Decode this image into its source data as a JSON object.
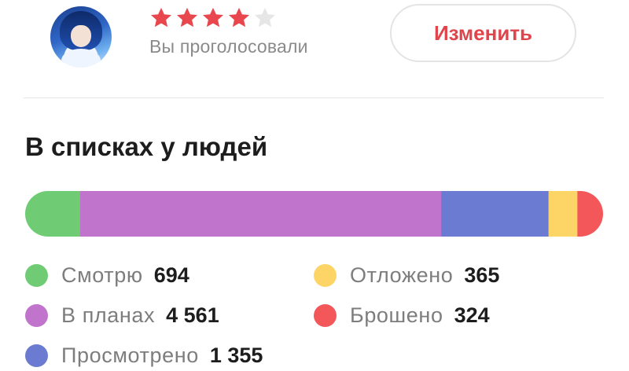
{
  "rating": {
    "stars_total": 5,
    "stars_filled": 4,
    "star_color": "#e9474e",
    "star_empty_color": "#e6e6e6",
    "vote_label": "Вы проголосовали",
    "change_button_label": "Изменить"
  },
  "lists": {
    "title": "В списках у людей",
    "items": [
      {
        "label": "Смотрю",
        "count": "694",
        "value": 694,
        "color": "#6fcc74"
      },
      {
        "label": "В планах",
        "count": "4 561",
        "value": 4561,
        "color": "#c074cc"
      },
      {
        "label": "Просмотрено",
        "count": "1 355",
        "value": 1355,
        "color": "#6b7bd1"
      },
      {
        "label": "Отложено",
        "count": "365",
        "value": 365,
        "color": "#fdd466"
      },
      {
        "label": "Брошено",
        "count": "324",
        "value": 324,
        "color": "#f3575a"
      }
    ]
  }
}
